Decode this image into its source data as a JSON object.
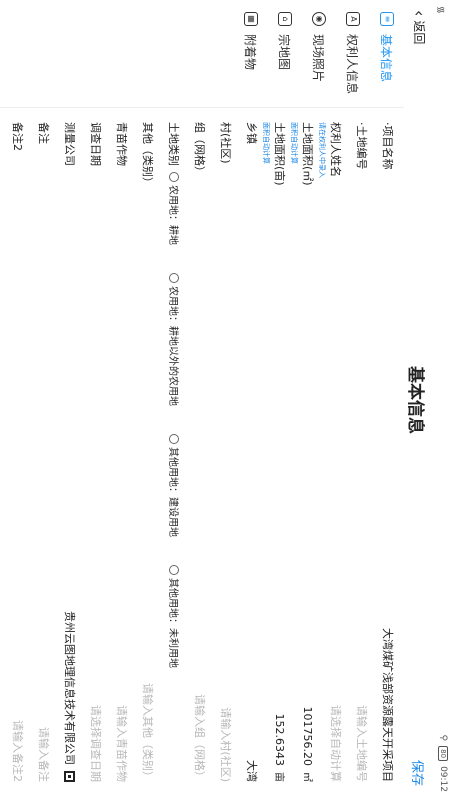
{
  "status": {
    "time": "09:12",
    "battery": "80"
  },
  "header": {
    "back_label": "返回",
    "title": "基本信息",
    "save_label": "保存"
  },
  "sidebar": {
    "items": [
      {
        "label": "基本信息",
        "icon": "list-icon"
      },
      {
        "label": "权利人信息",
        "icon": "id-card-icon"
      },
      {
        "label": "现场照片",
        "icon": "camera-icon"
      },
      {
        "label": "宗地图",
        "icon": "map-icon"
      },
      {
        "label": "附着物",
        "icon": "building-icon"
      }
    ]
  },
  "form": {
    "project_name": {
      "label": "·项目名称",
      "value": "大湾煤矿浅部资源露天开采项目"
    },
    "land_code": {
      "label": "·土地编号",
      "placeholder": "请输入土地编号"
    },
    "owner_name": {
      "label": "权利人姓名",
      "hint": "请在权利人中录入",
      "placeholder": "请选择自动计算"
    },
    "land_area_m2": {
      "label": "土地面积(㎡)",
      "hint": "面积自动计算",
      "value": "101756.20",
      "unit": "㎡"
    },
    "land_area_mu": {
      "label": "土地面积(亩)",
      "hint": "面积自动计算",
      "value": "152.6343",
      "unit": "亩"
    },
    "township": {
      "label": "乡镇",
      "value": "大湾"
    },
    "village": {
      "label": "村(社区)",
      "placeholder": "请输入村(社区)"
    },
    "group": {
      "label": "组（网格）",
      "placeholder": "请输入组（网格）"
    },
    "land_type": {
      "label": "土地类别",
      "options": [
        "农用地：耕地",
        "农用地：耕地以外的农用地",
        "其他用地：建设用地",
        "其他用地：未利用地"
      ]
    },
    "other": {
      "label": "其他（类别）",
      "placeholder": "请输入其他（类别）"
    },
    "crops": {
      "label": "青苗作物",
      "placeholder": "请输入青苗作物"
    },
    "survey_date": {
      "label": "调查日期",
      "placeholder": "请选择调查日期"
    },
    "survey_company": {
      "label": "测量公司",
      "value": "贵州云图地理信息技术有限公司"
    },
    "remark": {
      "label": "备注",
      "placeholder": "请输入备注"
    },
    "remark2": {
      "label": "备注2",
      "placeholder": "请输入备注2"
    }
  },
  "colors": {
    "accent": "#1e88e5",
    "text": "#222222",
    "placeholder": "#b8b8b8"
  }
}
